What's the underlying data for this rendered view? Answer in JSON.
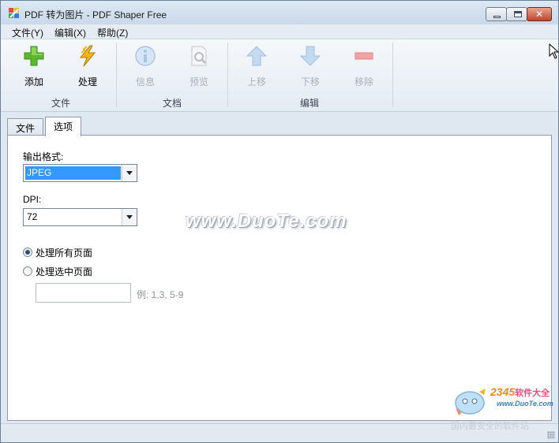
{
  "window": {
    "title": "PDF 转为图片 - PDF Shaper Free",
    "controls": {
      "minimize": "minimize",
      "maximize": "maximize",
      "close": "✕"
    }
  },
  "menu": [
    "文件(Y)",
    "编辑(X)",
    "帮助(Z)"
  ],
  "ribbon": {
    "tools": {
      "add": "添加",
      "process": "处理",
      "info": "信息",
      "preview": "预览",
      "up": "上移",
      "down": "下移",
      "remove": "移除"
    },
    "groups": {
      "file": "文件",
      "document": "文档",
      "edit": "编辑"
    }
  },
  "tabs": {
    "file": "文件",
    "options": "选项"
  },
  "options": {
    "output_format_label": "输出格式:",
    "output_format_value": "JPEG",
    "dpi_label": "DPI:",
    "dpi_value": "72",
    "radio_all": "处理所有页面",
    "radio_selected": "处理选中页面",
    "pages_value": "",
    "pages_hint": "例: 1,3, 5-9"
  },
  "watermark": "www.DuoTe.com",
  "logo": {
    "number": "2345",
    "sub": "软件大全",
    "url": "www.DuoTe.com",
    "tagline": "国内最安全的软件站"
  },
  "colors": {
    "selection": "#3399ff",
    "add_icon": "#5cb82e",
    "process_icon": "#f2b517",
    "disabled_icon": "#a9c6e6",
    "remove_icon": "#f2a3a3"
  }
}
